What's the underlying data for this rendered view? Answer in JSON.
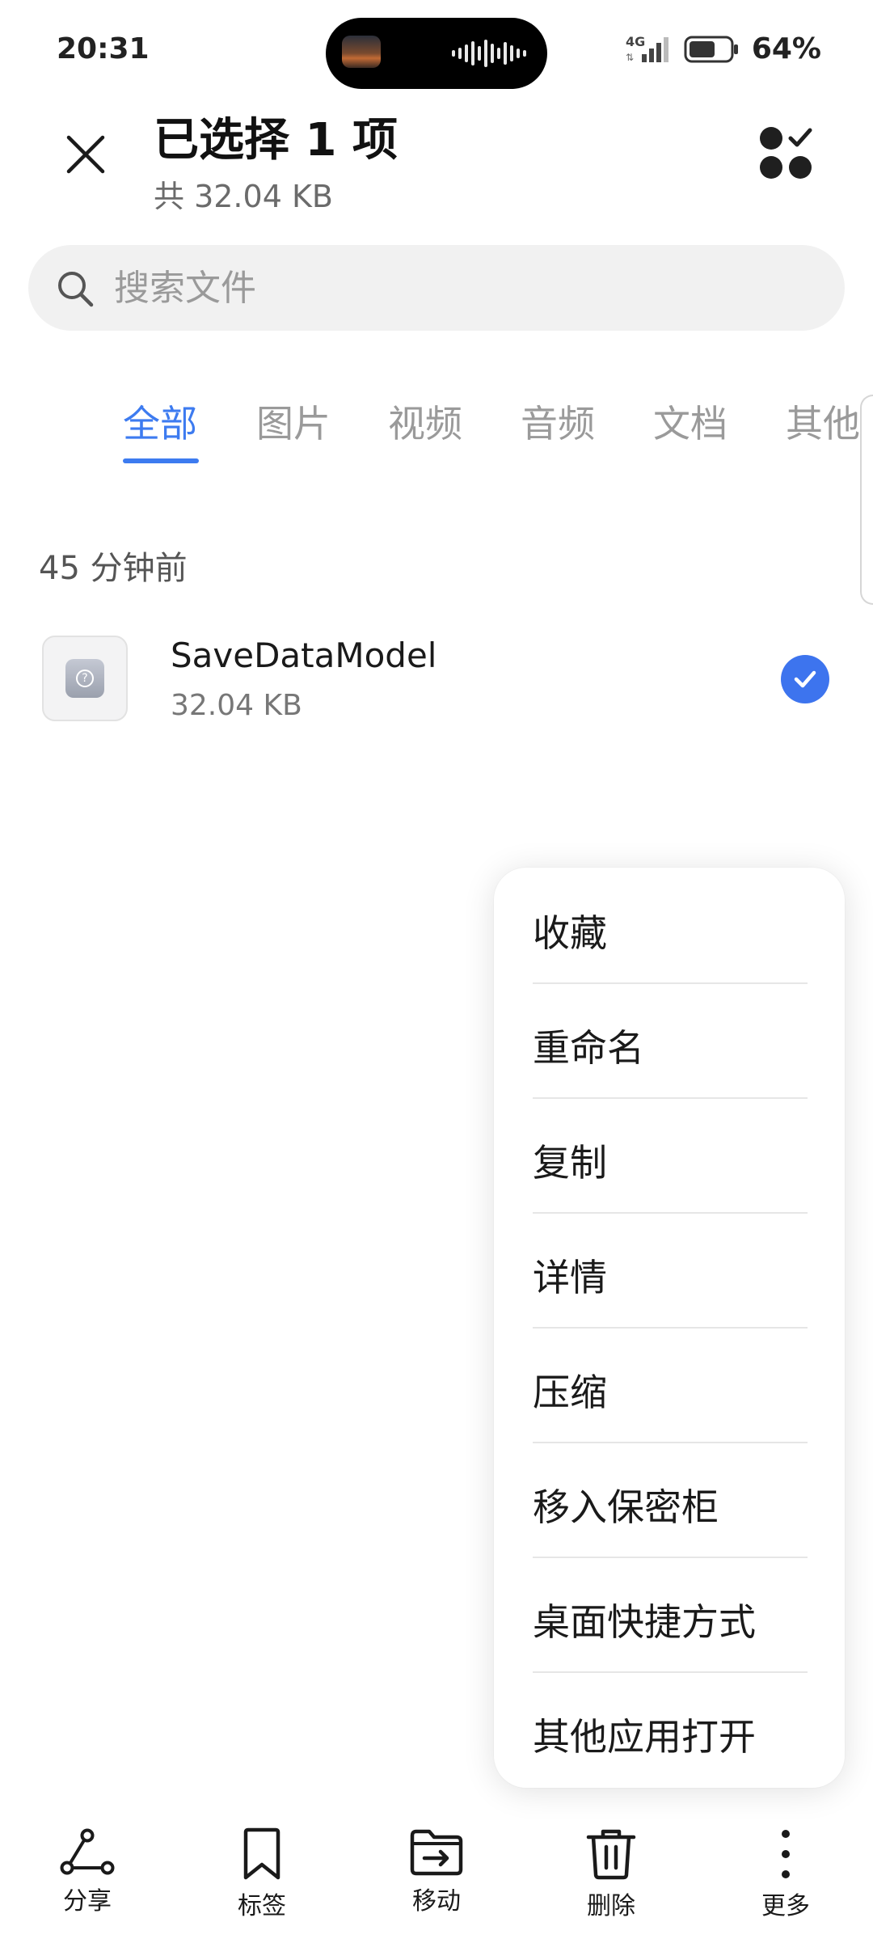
{
  "status_bar": {
    "time": "20:31",
    "network": "4G",
    "battery_pct": "64%",
    "battery_level": 0.64
  },
  "header": {
    "title": "已选择 1 项",
    "subtitle": "共 32.04 KB"
  },
  "search": {
    "placeholder": "搜索文件"
  },
  "tabs": [
    {
      "label": "全部",
      "active": true
    },
    {
      "label": "图片",
      "active": false
    },
    {
      "label": "视频",
      "active": false
    },
    {
      "label": "音频",
      "active": false
    },
    {
      "label": "文档",
      "active": false
    },
    {
      "label": "其他",
      "active": false
    }
  ],
  "section": {
    "label": "45 分钟前"
  },
  "files": [
    {
      "name": "SaveDataModel",
      "size": "32.04 KB",
      "selected": true
    }
  ],
  "menu": {
    "items": [
      {
        "label": "收藏"
      },
      {
        "label": "重命名"
      },
      {
        "label": "复制"
      },
      {
        "label": "详情"
      },
      {
        "label": "压缩"
      },
      {
        "label": "移入保密柜"
      },
      {
        "label": "桌面快捷方式"
      },
      {
        "label": "其他应用打开"
      }
    ]
  },
  "toolbar": {
    "items": [
      {
        "label": "分享",
        "icon": "share-icon"
      },
      {
        "label": "标签",
        "icon": "bookmark-icon"
      },
      {
        "label": "移动",
        "icon": "move-folder-icon"
      },
      {
        "label": "删除",
        "icon": "trash-icon"
      },
      {
        "label": "更多",
        "icon": "more-vertical-icon"
      }
    ]
  },
  "colors": {
    "accent": "#3d7bf0",
    "search_bg": "#f1f1f1",
    "muted_text": "#9a9a9a"
  }
}
